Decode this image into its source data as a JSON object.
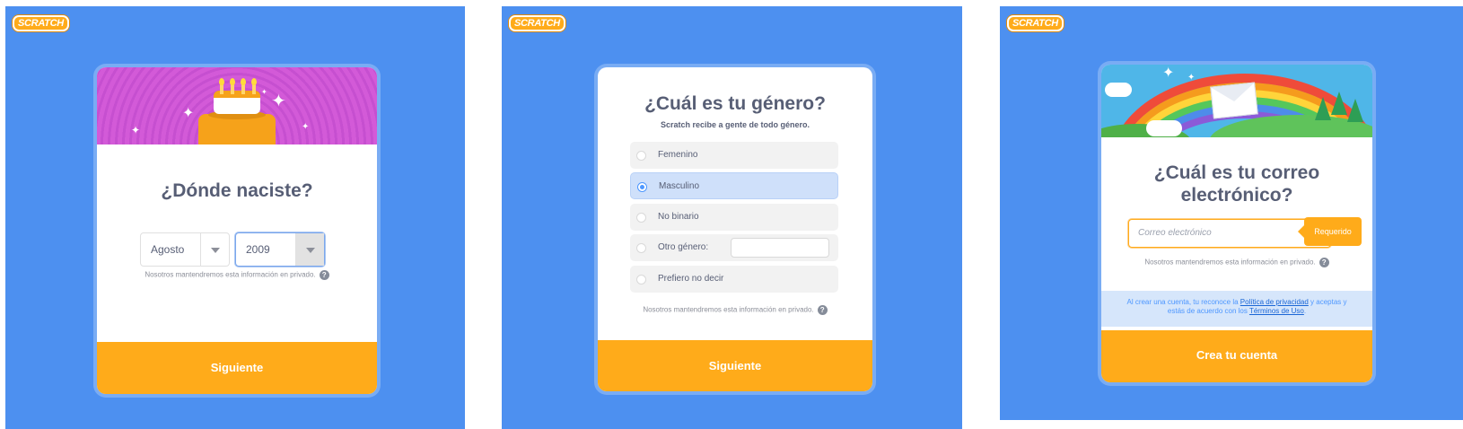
{
  "brand": {
    "logo_text": "SCRATCH",
    "accent_color": "#ffab1a",
    "background_color": "#4d90f0"
  },
  "birth_screen": {
    "title": "¿Dónde naciste?",
    "month_value": "Agosto",
    "year_value": "2009",
    "privacy_note": "Nosotros mantendremos esta información en privado.",
    "help_icon": "?",
    "next_button": "Siguiente"
  },
  "gender_screen": {
    "title": "¿Cuál es tu género?",
    "subtitle": "Scratch recibe a gente de todo género.",
    "options": [
      {
        "label": "Femenino",
        "selected": false
      },
      {
        "label": "Masculino",
        "selected": true
      },
      {
        "label": "No binario",
        "selected": false
      },
      {
        "label": "Otro género:",
        "selected": false
      },
      {
        "label": "Prefiero no decir",
        "selected": false
      }
    ],
    "privacy_note": "Nosotros mantendremos esta información en privado.",
    "help_icon": "?",
    "next_button": "Siguiente"
  },
  "email_screen": {
    "title_line1": "¿Cuál es tu correo",
    "title_line2": "electrónico?",
    "email_placeholder": "Correo electrónico",
    "email_value": "",
    "required_tooltip": "Requerido",
    "privacy_note": "Nosotros mantendremos esta información en privado.",
    "help_icon": "?",
    "terms_text_1": "Al crear una cuenta, tu reconoce la ",
    "privacy_policy_link": "Política de privacidad",
    "terms_text_2": " y aceptas y estás de acuerdo con los ",
    "terms_link": "Términos de Uso",
    "terms_text_3": ".",
    "create_button": "Crea tu cuenta"
  }
}
